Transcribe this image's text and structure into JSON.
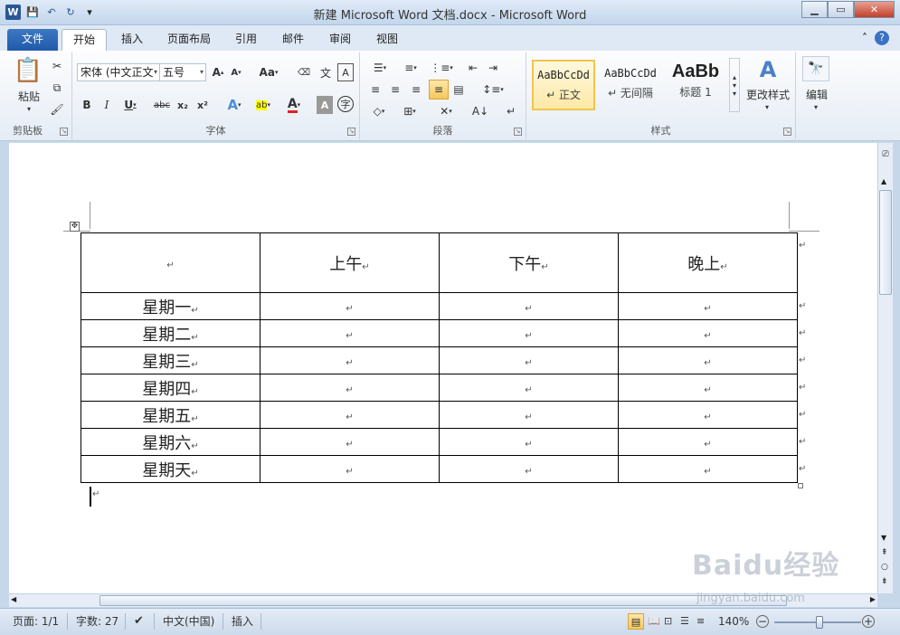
{
  "window": {
    "title": "新建 Microsoft Word 文档.docx - Microsoft Word"
  },
  "tabs": [
    {
      "label": "文件"
    },
    {
      "label": "开始"
    },
    {
      "label": "插入"
    },
    {
      "label": "页面布局"
    },
    {
      "label": "引用"
    },
    {
      "label": "邮件"
    },
    {
      "label": "审阅"
    },
    {
      "label": "视图"
    }
  ],
  "ribbon": {
    "clipboard": {
      "label": "剪贴板",
      "paste": "粘贴"
    },
    "font": {
      "label": "字体",
      "font_name": "宋体 (中文正文",
      "font_size": "五号",
      "aa": "Aa"
    },
    "paragraph": {
      "label": "段落"
    },
    "styles": {
      "label": "样式",
      "items": [
        {
          "preview": "AaBbCcDd",
          "name": "↵ 正文"
        },
        {
          "preview": "AaBbCcDd",
          "name": "↵ 无间隔"
        },
        {
          "preview": "AaBb",
          "name": "标题 1"
        }
      ],
      "change": "更改样式"
    },
    "editing": {
      "label": "编辑"
    }
  },
  "document": {
    "headers": [
      "",
      "上午",
      "下午",
      "晚上"
    ],
    "rows": [
      "星期一",
      "星期二",
      "星期三",
      "星期四",
      "星期五",
      "星期六",
      "星期天"
    ],
    "mark": "↵"
  },
  "status": {
    "page": "页面: 1/1",
    "words": "字数: 27",
    "language": "中文(中国)",
    "mode": "插入",
    "zoom": "140%"
  },
  "watermark": {
    "logo": "Baidu经验",
    "url": "jingyan.baidu.com"
  }
}
